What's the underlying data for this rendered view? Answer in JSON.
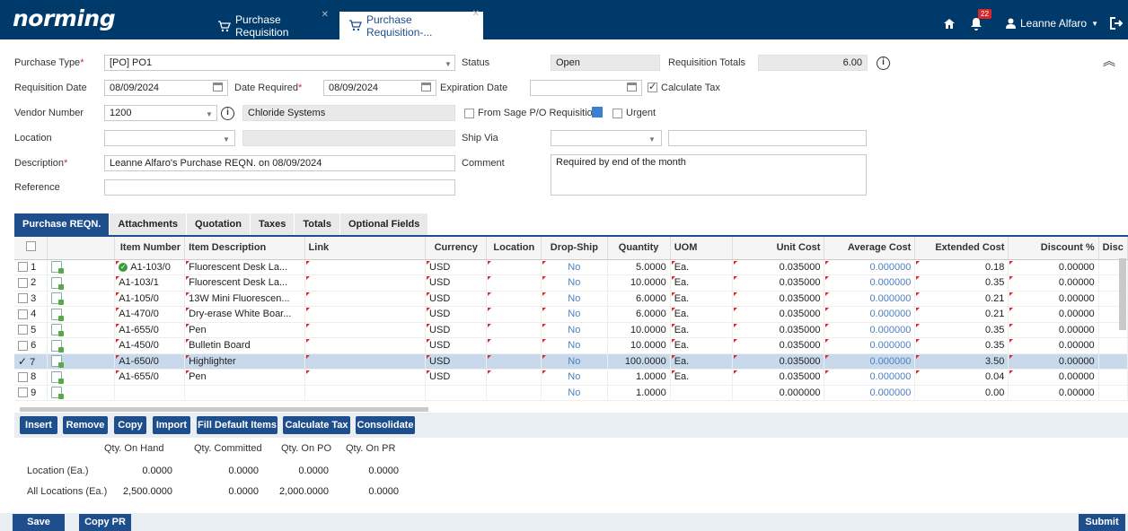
{
  "app": {
    "logo": "norming"
  },
  "tabs": [
    {
      "label": "Purchase Requisition"
    },
    {
      "label": "Purchase Requisition-..."
    }
  ],
  "topbar": {
    "notification_count": "22",
    "user_name": "Leanne Alfaro"
  },
  "form": {
    "purchase_type_label": "Purchase Type",
    "purchase_type_value": "[PO] PO1",
    "status_label": "Status",
    "status_value": "Open",
    "req_totals_label": "Requisition Totals",
    "req_totals_value": "6.00",
    "req_date_label": "Requisition Date",
    "req_date_value": "08/09/2024",
    "date_required_label": "Date Required",
    "date_required_value": "08/09/2024",
    "expiration_label": "Expiration Date",
    "expiration_value": "",
    "calc_tax_label": "Calculate Tax",
    "vendor_label": "Vendor Number",
    "vendor_value": "1200",
    "vendor_name": "Chloride Systems",
    "from_sage_label": "From Sage P/O Requisition",
    "urgent_label": "Urgent",
    "location_label": "Location",
    "location_value": "",
    "ship_via_label": "Ship Via",
    "description_label": "Description",
    "description_value": "Leanne Alfaro's Purchase REQN. on 08/09/2024",
    "comment_label": "Comment",
    "comment_value": "Required by end of the month",
    "reference_label": "Reference",
    "reference_value": ""
  },
  "section_tabs": [
    "Purchase REQN.",
    "Attachments",
    "Quotation",
    "Taxes",
    "Totals",
    "Optional Fields"
  ],
  "grid": {
    "columns": [
      "Item Number",
      "Item Description",
      "Link",
      "Currency",
      "Location",
      "Drop-Ship",
      "Quantity",
      "UOM",
      "Unit Cost",
      "Average Cost",
      "Extended Cost",
      "Discount %",
      "Disc"
    ],
    "rows": [
      {
        "n": "1",
        "item": "A1-103/0",
        "desc": "Fluorescent Desk La...",
        "cur": "USD",
        "drop": "No",
        "qty": "5.0000",
        "uom": "Ea.",
        "unit": "0.035000",
        "avg": "0.000000",
        "ext": "0.18",
        "disc": "0.00000"
      },
      {
        "n": "2",
        "item": "A1-103/1",
        "desc": "Fluorescent Desk La...",
        "cur": "USD",
        "drop": "No",
        "qty": "10.0000",
        "uom": "Ea.",
        "unit": "0.035000",
        "avg": "0.000000",
        "ext": "0.35",
        "disc": "0.00000"
      },
      {
        "n": "3",
        "item": "A1-105/0",
        "desc": "13W Mini Fluorescen...",
        "cur": "USD",
        "drop": "No",
        "qty": "6.0000",
        "uom": "Ea.",
        "unit": "0.035000",
        "avg": "0.000000",
        "ext": "0.21",
        "disc": "0.00000"
      },
      {
        "n": "4",
        "item": "A1-470/0",
        "desc": "Dry-erase White Boar...",
        "cur": "USD",
        "drop": "No",
        "qty": "6.0000",
        "uom": "Ea.",
        "unit": "0.035000",
        "avg": "0.000000",
        "ext": "0.21",
        "disc": "0.00000"
      },
      {
        "n": "5",
        "item": "A1-655/0",
        "desc": "Pen",
        "cur": "USD",
        "drop": "No",
        "qty": "10.0000",
        "uom": "Ea.",
        "unit": "0.035000",
        "avg": "0.000000",
        "ext": "0.35",
        "disc": "0.00000"
      },
      {
        "n": "6",
        "item": "A1-450/0",
        "desc": "Bulletin Board",
        "cur": "USD",
        "drop": "No",
        "qty": "10.0000",
        "uom": "Ea.",
        "unit": "0.035000",
        "avg": "0.000000",
        "ext": "0.35",
        "disc": "0.00000"
      },
      {
        "n": "7",
        "item": "A1-650/0",
        "desc": "Highlighter",
        "cur": "USD",
        "drop": "No",
        "qty": "100.0000",
        "uom": "Ea.",
        "unit": "0.035000",
        "avg": "0.000000",
        "ext": "3.50",
        "disc": "0.00000"
      },
      {
        "n": "8",
        "item": "A1-655/0",
        "desc": "Pen",
        "cur": "USD",
        "drop": "No",
        "qty": "1.0000",
        "uom": "Ea.",
        "unit": "0.035000",
        "avg": "0.000000",
        "ext": "0.04",
        "disc": "0.00000"
      },
      {
        "n": "9",
        "item": "",
        "desc": "",
        "cur": "",
        "drop": "No",
        "qty": "1.0000",
        "uom": "",
        "unit": "0.000000",
        "avg": "0.000000",
        "ext": "0.00",
        "disc": "0.00000"
      }
    ]
  },
  "actions": [
    "Insert",
    "Remove",
    "Copy",
    "Import",
    "Fill Default Items",
    "Calculate Tax",
    "Consolidate"
  ],
  "quantities": {
    "headers": [
      "Qty. On Hand",
      "Qty. Committed",
      "Qty. On PO",
      "Qty. On PR"
    ],
    "location_label": "Location (Ea.)",
    "location_values": [
      "0.0000",
      "0.0000",
      "0.0000",
      "0.0000"
    ],
    "all_label": "All Locations (Ea.)",
    "all_values": [
      "2,500.0000",
      "0.0000",
      "2,000.0000",
      "0.0000"
    ]
  },
  "footer": {
    "save": "Save",
    "copy_pr": "Copy PR",
    "submit": "Submit"
  },
  "colors": {
    "topbar": "#003a6a",
    "primary": "#1f4e8c",
    "selected_row": "#c9d9ec"
  }
}
